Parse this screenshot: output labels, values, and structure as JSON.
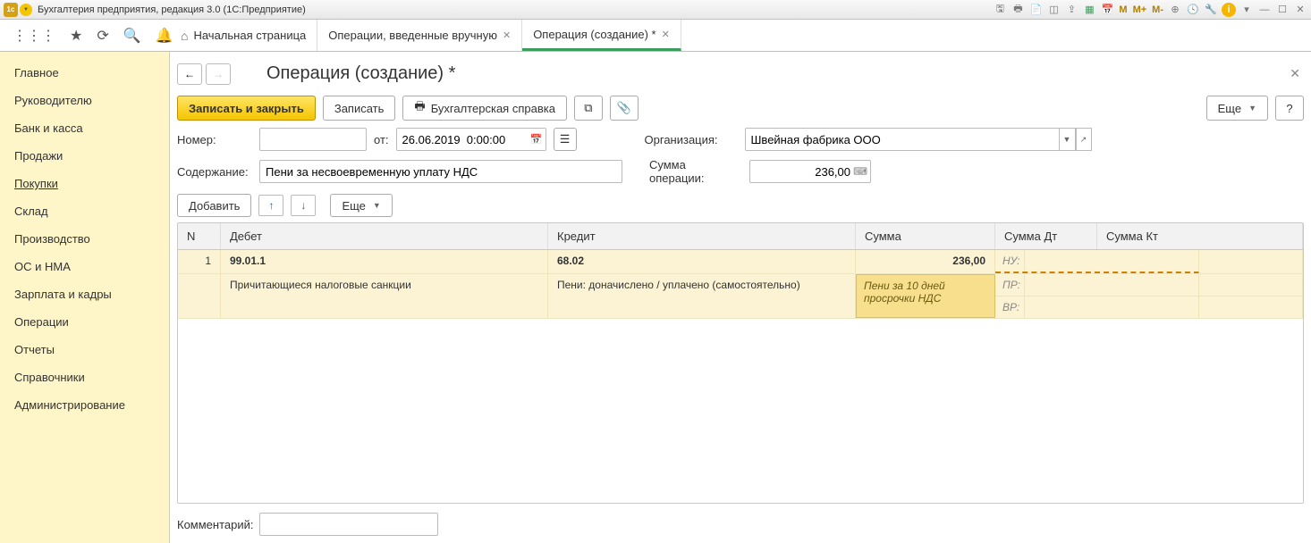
{
  "title": "Бухгалтерия предприятия, редакция 3.0  (1С:Предприятие)",
  "tabs": [
    {
      "label": "Начальная страница",
      "closable": false,
      "icon": "home"
    },
    {
      "label": "Операции, введенные вручную",
      "closable": true
    },
    {
      "label": "Операция (создание) *",
      "closable": true,
      "active": true
    }
  ],
  "sidebar": {
    "items": [
      "Главное",
      "Руководителю",
      "Банк и касса",
      "Продажи",
      "Покупки",
      "Склад",
      "Производство",
      "ОС и НМА",
      "Зарплата и кадры",
      "Операции",
      "Отчеты",
      "Справочники",
      "Администрирование"
    ],
    "selected": 4
  },
  "page_title": "Операция (создание) *",
  "commands": {
    "save_close": "Записать и закрыть",
    "save": "Записать",
    "report": "Бухгалтерская справка",
    "more": "Еще"
  },
  "form": {
    "num_label": "Номер:",
    "num_value": "",
    "from_label": "от:",
    "date_value": "26.06.2019  0:00:00",
    "org_label": "Организация:",
    "org_value": "Швейная фабрика ООО",
    "content_label": "Содержание:",
    "content_value": "Пени за несвоевременную уплату НДС",
    "sum_label": "Сумма операции:",
    "sum_value": "236,00"
  },
  "table": {
    "add": "Добавить",
    "more": "Еще",
    "headers": {
      "n": "N",
      "debit": "Дебет",
      "credit": "Кредит",
      "sum": "Сумма",
      "sumdt": "Сумма Дт",
      "sumkt": "Сумма Кт"
    },
    "row": {
      "n": "1",
      "debit": "99.01.1",
      "credit": "68.02",
      "sum": "236,00",
      "debit_sub": "Причитающиеся налоговые санкции",
      "credit_sub": "Пени: доначислено / уплачено (самостоятельно)",
      "sum_sub": "Пени за 10 дней просрочки НДС",
      "nu": "НУ:",
      "pr": "ПР:",
      "vr": "ВР:"
    }
  },
  "comment_label": "Комментарий:",
  "comment_value": ""
}
